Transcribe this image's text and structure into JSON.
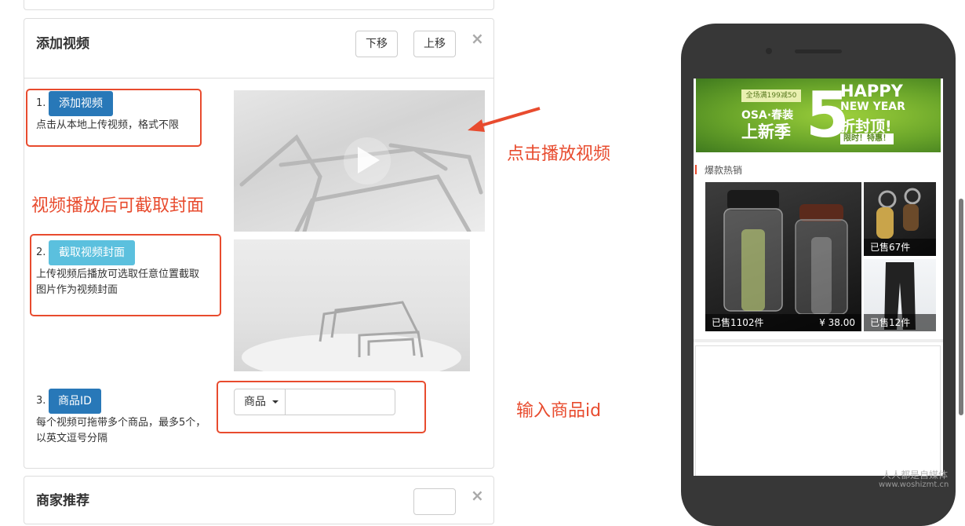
{
  "panel": {
    "title": "添加视频",
    "down_label": "下移",
    "up_label": "上移",
    "close_symbol": "×"
  },
  "steps": [
    {
      "num": "1.",
      "button": "添加视频",
      "desc": "点击从本地上传视频，格式不限"
    },
    {
      "num": "2.",
      "button": "截取视频封面",
      "desc_line1": "上传视频后播放可选取任意位置截取",
      "desc_line2": "图片作为视频封面"
    },
    {
      "num": "3.",
      "button": "商品ID",
      "desc_line1": "每个视频可拖带多个商品，最多5个，",
      "desc_line2": "以英文逗号分隔"
    }
  ],
  "product_input": {
    "dropdown_label": "商品",
    "value": ""
  },
  "annotations": {
    "play": "点击播放视频",
    "cover": "视频播放后可截取封面",
    "input_id": "输入商品id"
  },
  "next_panel": {
    "title": "商家推荐",
    "close_symbol": "×"
  },
  "phone": {
    "banner": {
      "small_top": "全场满199减50",
      "brand": "OSA·春装",
      "headline": "上新季",
      "big_number": "5",
      "happy": "HAPPY",
      "new_year": "NEW YEAR",
      "discount": "折封顶!",
      "limited": "限时！特惠！"
    },
    "section_title": "爆款热销",
    "products": [
      {
        "sold": "已售1102件",
        "price": "¥ 38.00"
      },
      {
        "sold": "已售67件"
      },
      {
        "sold": "已售12件"
      }
    ]
  },
  "watermark": {
    "line1": "人人都是自媒体",
    "line2": "www.woshizmt.cn"
  },
  "colors": {
    "accent_red": "#e84b2e",
    "btn_blue": "#2878b8",
    "btn_cyan": "#5bc0de",
    "phone_body": "#373737"
  }
}
